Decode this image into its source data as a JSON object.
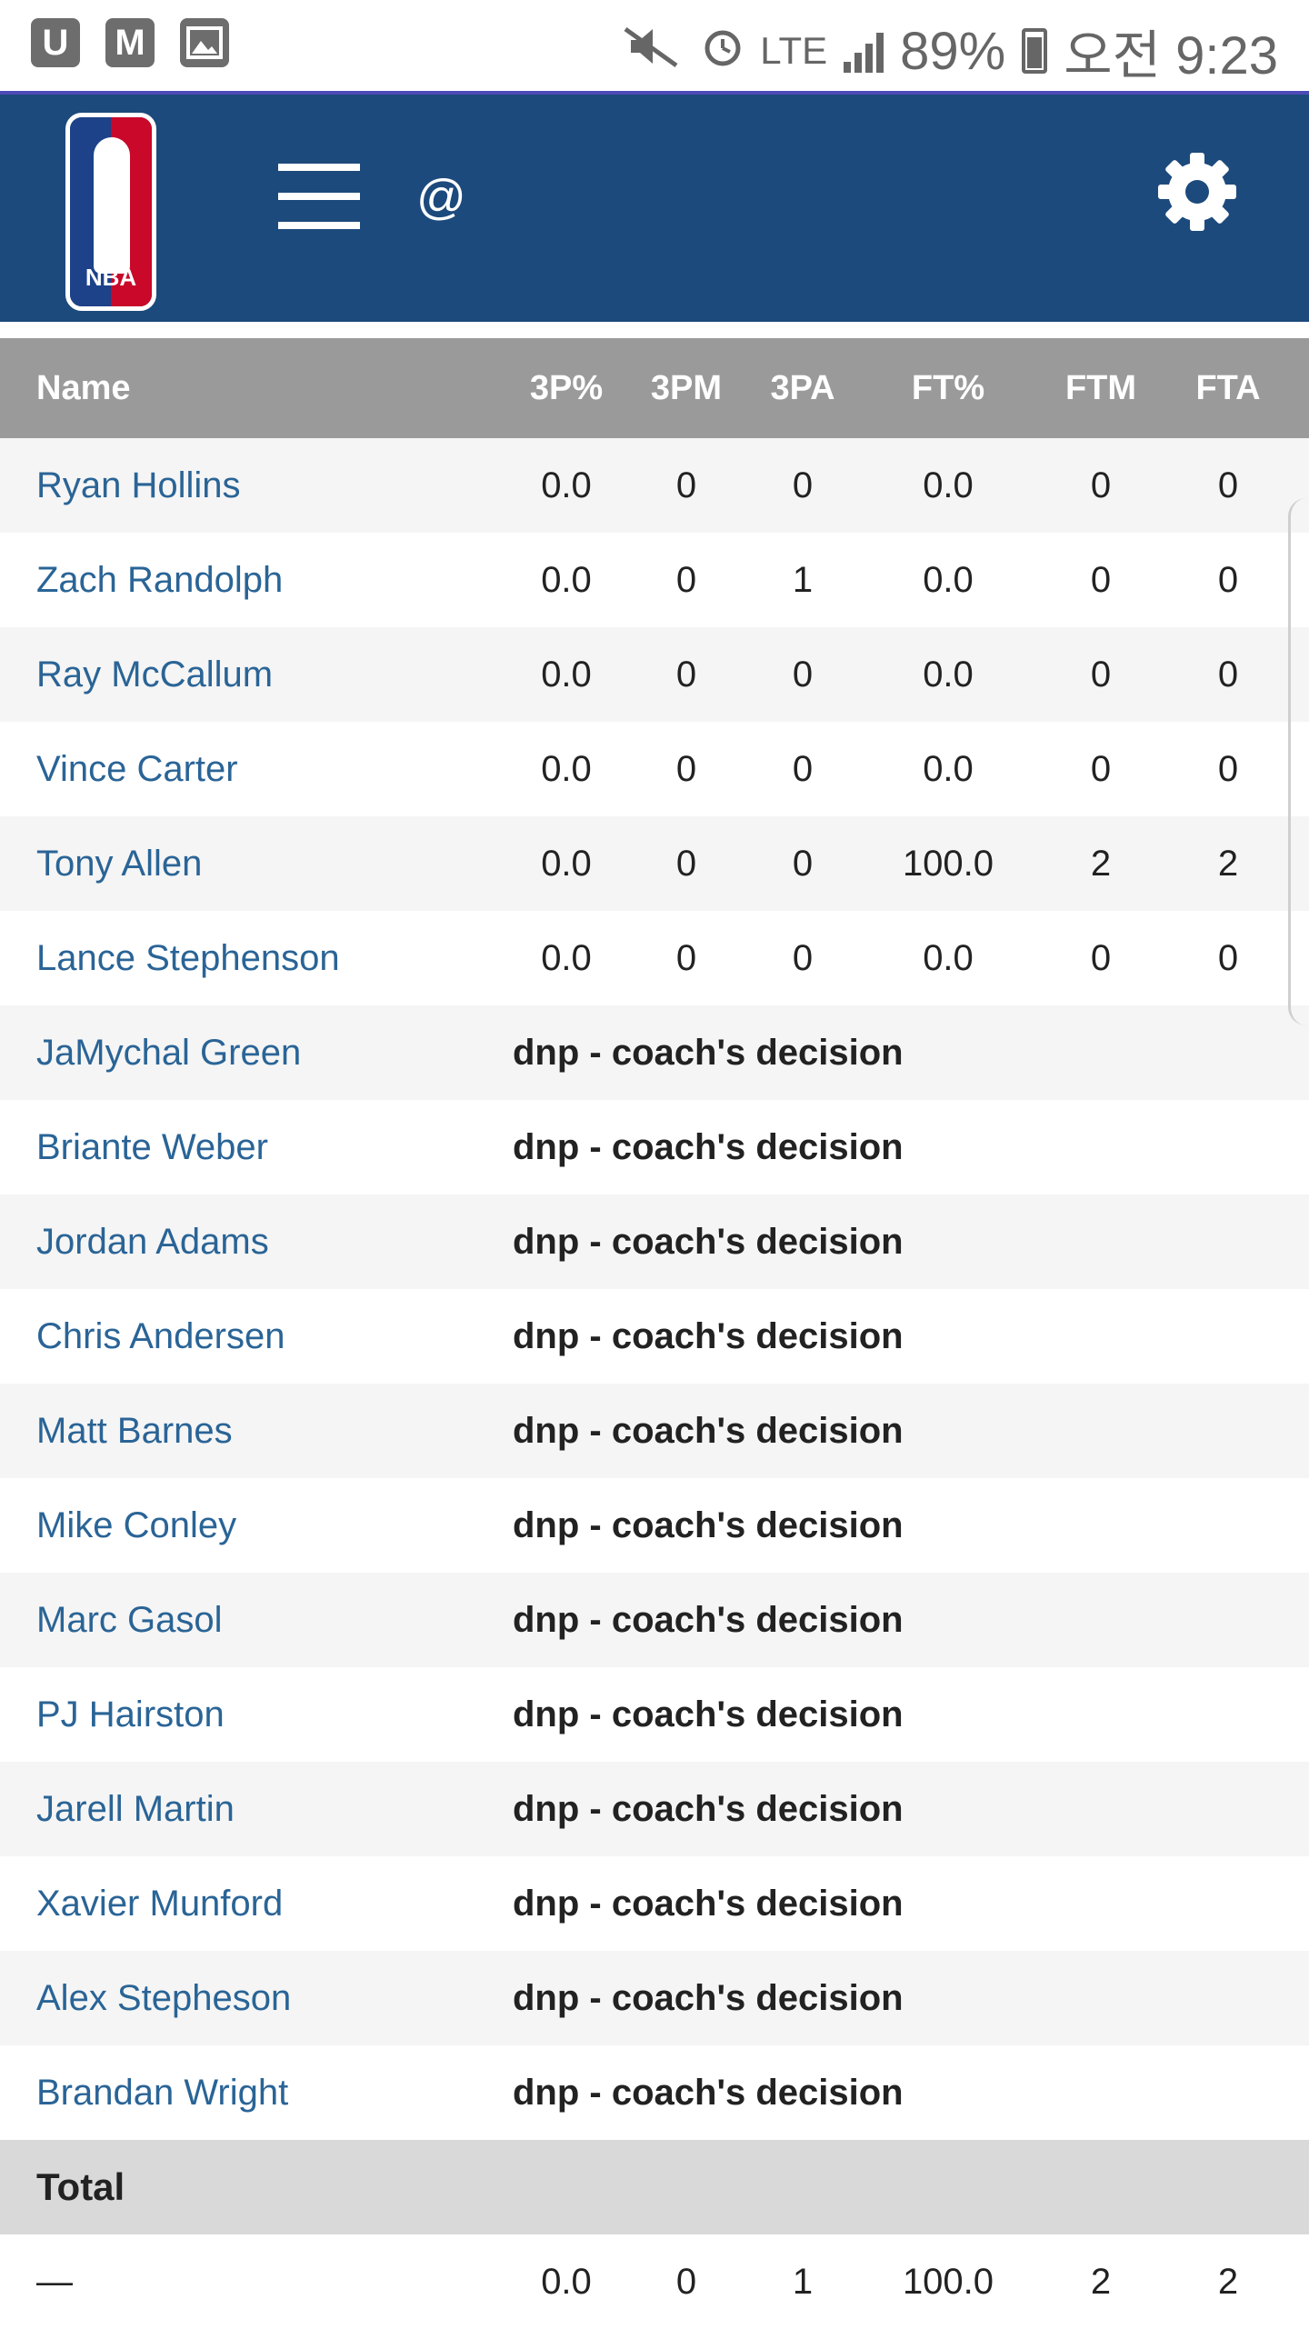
{
  "status_bar": {
    "left_icons": [
      "U",
      "M",
      "image-icon"
    ],
    "network": "LTE",
    "battery": "89%",
    "time": "오전 9:23"
  },
  "header": {
    "logo_text": "NBA",
    "at_label": "@"
  },
  "table": {
    "columns": [
      "Name",
      "3P%",
      "3PM",
      "3PA",
      "FT%",
      "FTM",
      "FTA"
    ],
    "players": [
      {
        "name": "Ryan Hollins",
        "stats": [
          "0.0",
          "0",
          "0",
          "0.0",
          "0",
          "0"
        ]
      },
      {
        "name": "Zach Randolph",
        "stats": [
          "0.0",
          "0",
          "1",
          "0.0",
          "0",
          "0"
        ]
      },
      {
        "name": "Ray McCallum",
        "stats": [
          "0.0",
          "0",
          "0",
          "0.0",
          "0",
          "0"
        ]
      },
      {
        "name": "Vince Carter",
        "stats": [
          "0.0",
          "0",
          "0",
          "0.0",
          "0",
          "0"
        ]
      },
      {
        "name": "Tony Allen",
        "stats": [
          "0.0",
          "0",
          "0",
          "100.0",
          "2",
          "2"
        ]
      },
      {
        "name": "Lance Stephenson",
        "stats": [
          "0.0",
          "0",
          "0",
          "0.0",
          "0",
          "0"
        ]
      },
      {
        "name": "JaMychal Green",
        "dnp": "dnp - coach's decision"
      },
      {
        "name": "Briante Weber",
        "dnp": "dnp - coach's decision"
      },
      {
        "name": "Jordan Adams",
        "dnp": "dnp - coach's decision"
      },
      {
        "name": "Chris Andersen",
        "dnp": "dnp - coach's decision"
      },
      {
        "name": "Matt Barnes",
        "dnp": "dnp - coach's decision"
      },
      {
        "name": "Mike Conley",
        "dnp": "dnp - coach's decision"
      },
      {
        "name": "Marc Gasol",
        "dnp": "dnp - coach's decision"
      },
      {
        "name": "PJ Hairston",
        "dnp": "dnp - coach's decision"
      },
      {
        "name": "Jarell Martin",
        "dnp": "dnp - coach's decision"
      },
      {
        "name": "Xavier Munford",
        "dnp": "dnp - coach's decision"
      },
      {
        "name": "Alex Stepheson",
        "dnp": "dnp - coach's decision"
      },
      {
        "name": "Brandan Wright",
        "dnp": "dnp - coach's decision"
      }
    ],
    "total_label": "Total",
    "total_row": {
      "label": "—",
      "stats": [
        "0.0",
        "0",
        "1",
        "100.0",
        "2",
        "2"
      ]
    }
  }
}
